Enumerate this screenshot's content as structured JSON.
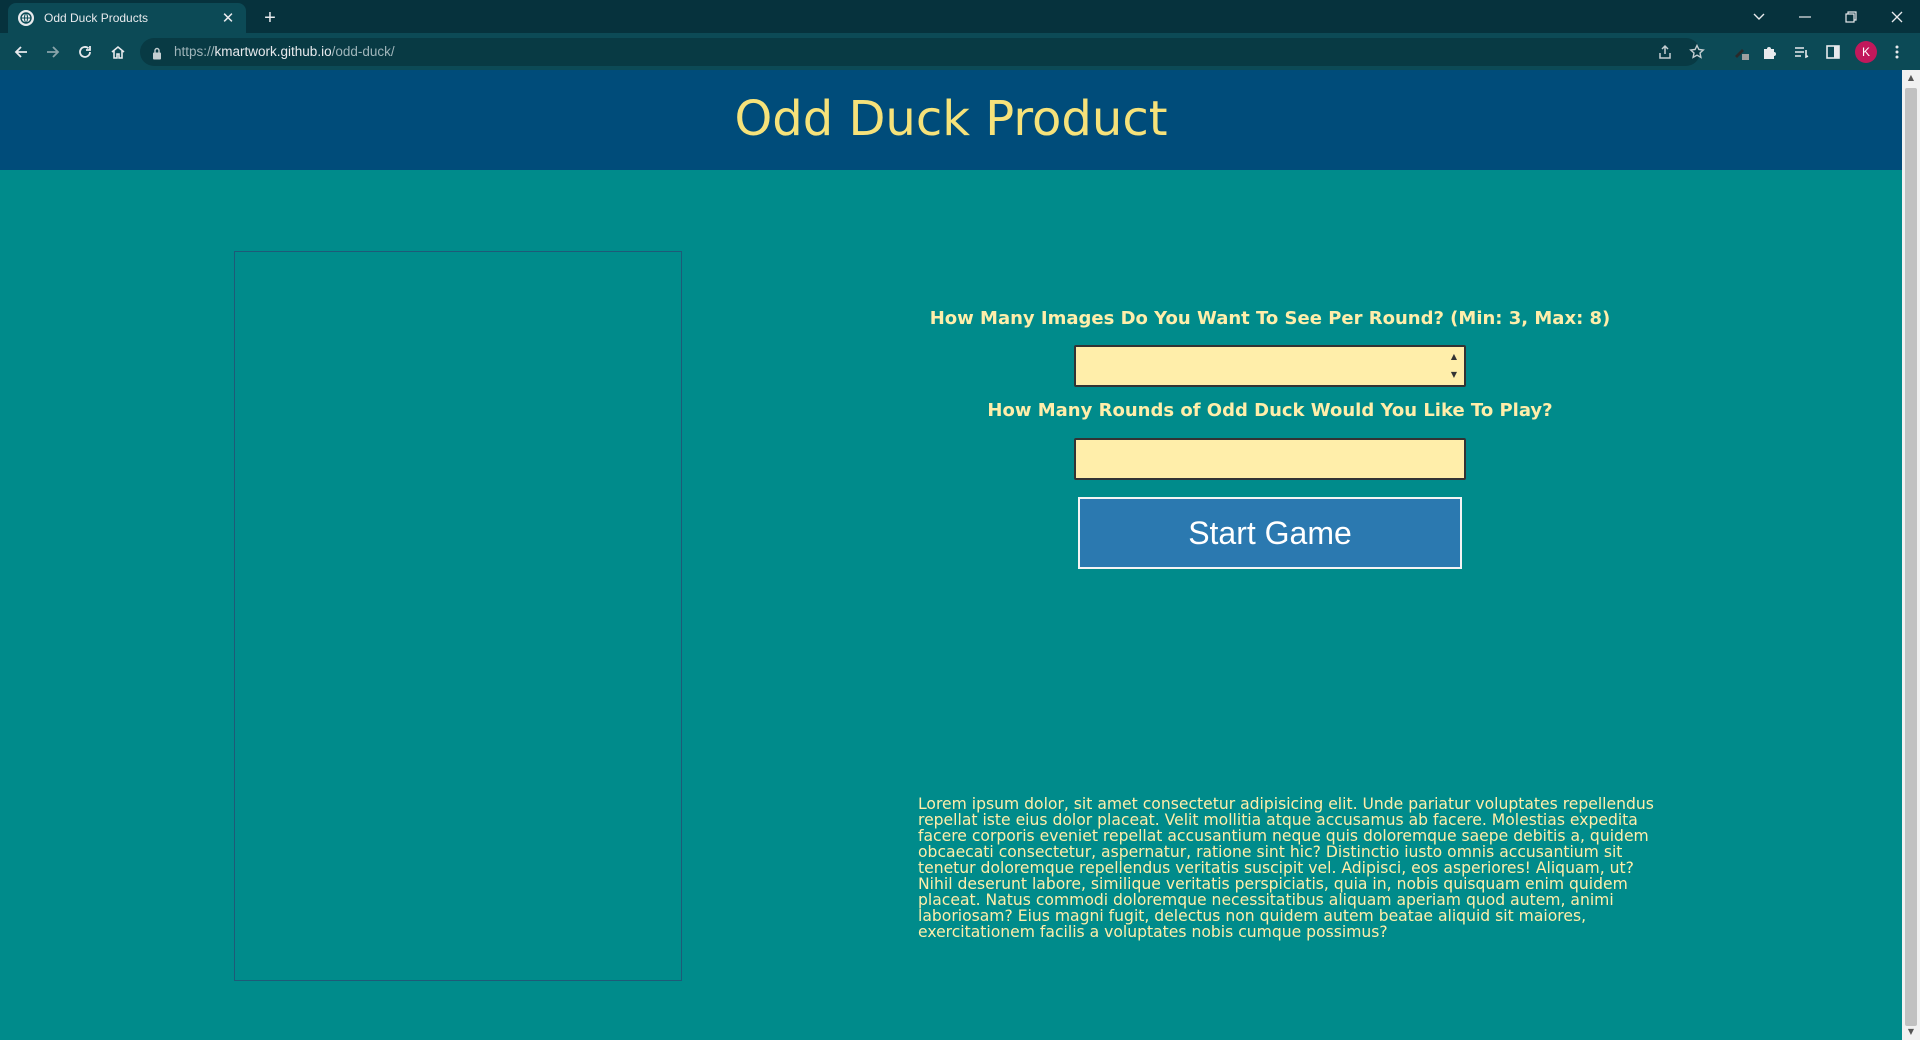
{
  "browser": {
    "tab_title": "Odd Duck Products",
    "tab_close": "✕",
    "new_tab": "+",
    "url_scheme": "https://",
    "url_host": "kmartwork.github.io",
    "url_path": "/odd-duck/",
    "avatar_letter": "K"
  },
  "header": {
    "title": "Odd Duck Product"
  },
  "form": {
    "images_label": "How Many Images Do You Want To See Per Round? (Min: 3, Max: 8)",
    "images_value": "",
    "rounds_label": "How Many Rounds of Odd Duck Would You Like To Play?",
    "rounds_value": "",
    "start_button": "Start Game"
  },
  "description": "Lorem ipsum dolor, sit amet consectetur adipisicing elit. Unde pariatur voluptates repellendus repellat iste eius dolor placeat. Velit mollitia atque accusamus ab facere. Molestias expedita facere corporis eveniet repellat accusantium neque quis doloremque saepe debitis a, quidem obcaecati consectetur, aspernatur, ratione sint hic? Distinctio iusto omnis accusantium sit tenetur doloremque repellendus veritatis suscipit vel. Adipisci, eos asperiores! Aliquam, ut? Nihil deserunt labore, similique veritatis perspiciatis, quia in, nobis quisquam enim quidem placeat. Natus commodi doloremque necessitatibus aliquam aperiam quod autem, animi laboriosam? Eius magni fugit, delectus non quidem autem beatae aliquid sit maiores, exercitationem facilis a voluptates nobis cumque possimus?",
  "colors": {
    "page_background": "#008b8b",
    "header_background": "#004c7a",
    "title_color": "#f6e27a",
    "label_color": "#ffeeaa",
    "input_background": "#ffeeaa",
    "button_background": "#2b79b0"
  }
}
